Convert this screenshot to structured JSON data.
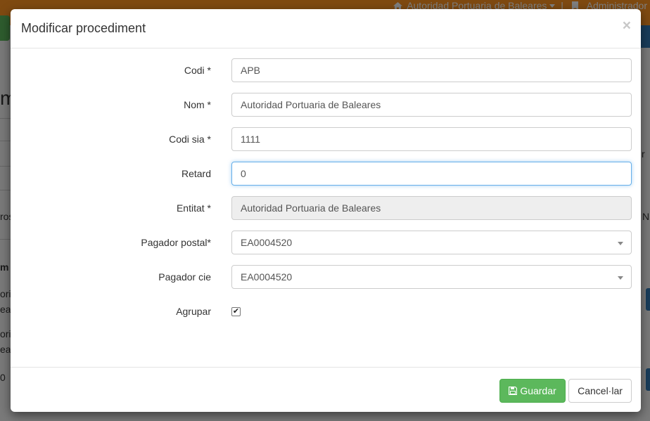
{
  "background": {
    "entity_menu": "Autoridad Portuaria de Baleares",
    "role_menu": "Administrador",
    "blue_button_fragment": "s",
    "title_fragment": "m",
    "column_fragment": "r",
    "row_fragment_a": "ros",
    "row_fragment_b": "N",
    "table_header_fragment": "m",
    "cell_fragments": [
      "oric",
      "ear",
      "oric",
      "ear",
      "0"
    ],
    "icons": [
      "home-icon",
      "caret-down-icon",
      "bookmark-icon"
    ]
  },
  "modal": {
    "title": "Modificar procediment",
    "close_label": "×",
    "fields": {
      "codi": {
        "label": "Codi *",
        "value": "APB"
      },
      "nom": {
        "label": "Nom *",
        "value": "Autoridad Portuaria de Baleares"
      },
      "codi_sia": {
        "label": "Codi sia *",
        "value": "1111"
      },
      "retard": {
        "label": "Retard",
        "value": "0"
      },
      "entitat": {
        "label": "Entitat *",
        "value": "Autoridad Portuaria de Baleares"
      },
      "pagador_postal": {
        "label": "Pagador postal*",
        "value": "EA0004520"
      },
      "pagador_cie": {
        "label": "Pagador cie",
        "value": "EA0004520"
      },
      "agrupar": {
        "label": "Agrupar",
        "checked": true,
        "mark": "✔"
      }
    },
    "footer": {
      "save_label": "Guardar",
      "save_icon": "floppy-disk-icon",
      "cancel_label": "Cancel·lar"
    }
  },
  "colors": {
    "header_orange": "#ff9523",
    "success_green": "#5cb85c",
    "primary_blue": "#337ab7",
    "focus_blue": "#66afe9"
  }
}
